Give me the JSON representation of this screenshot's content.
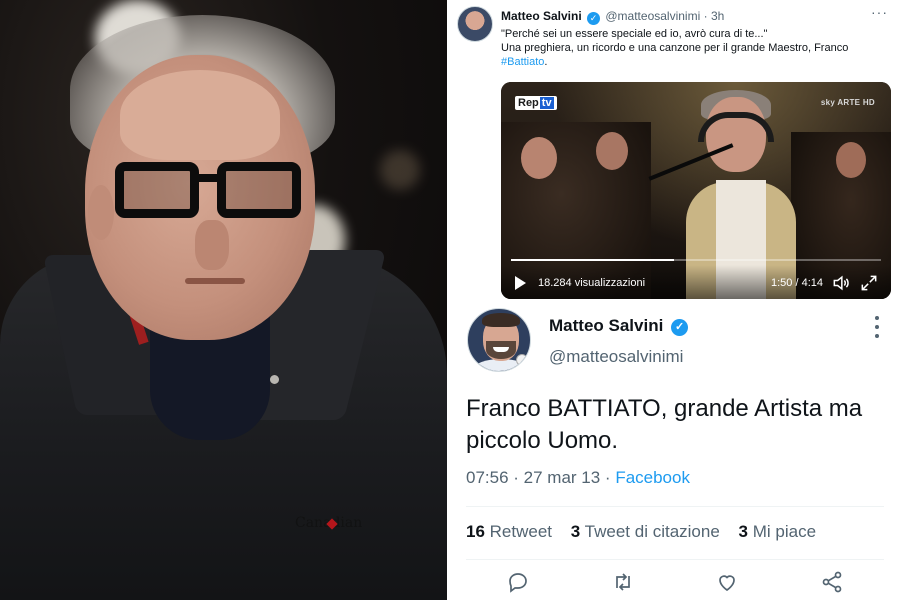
{
  "photo": {
    "jacket_logo": "Canadian"
  },
  "top_tweet": {
    "author_name": "Matteo Salvini",
    "handle": "@matteosalvinimi",
    "time_sep": "·",
    "time": "3h",
    "more": "···",
    "line1": "\"Perché sei un essere speciale ed io, avrò cura di te...\"",
    "line2": "Una preghiera, un ricordo e una canzone per il grande Maestro, Franco",
    "hashtag": "#Battiato",
    "after_hashtag": ".",
    "video": {
      "logo_main": "Rep",
      "logo_tv": "tv",
      "channel": "sky ARTE HD",
      "views": "18.284 visualizzazioni",
      "time": "1:50 / 4:14",
      "progress": 0.44
    }
  },
  "main_tweet": {
    "author_name": "Matteo Salvini",
    "handle": "@matteosalvinimi",
    "text": "Franco BATTIATO, grande Artista ma piccolo Uomo.",
    "time": "07:56 · 27 mar 13 · ",
    "source": "Facebook",
    "stats": [
      {
        "count": "16",
        "label": "Retweet"
      },
      {
        "count": "3",
        "label": "Tweet di citazione"
      },
      {
        "count": "3",
        "label": "Mi piace"
      }
    ]
  },
  "colors": {
    "accent": "#1d9bf0",
    "secondary_text": "#536471",
    "primary_text": "#0f1419"
  }
}
